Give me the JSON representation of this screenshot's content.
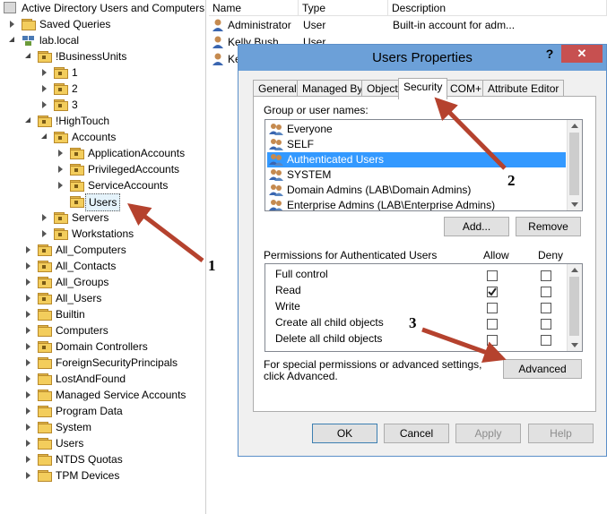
{
  "tree": {
    "root": "Active Directory Users and Computers",
    "items": [
      {
        "label": "Saved Queries"
      },
      {
        "label": "lab.local"
      },
      {
        "label": "!BusinessUnits"
      },
      {
        "label": "1"
      },
      {
        "label": "2"
      },
      {
        "label": "3"
      },
      {
        "label": "!HighTouch"
      },
      {
        "label": "Accounts"
      },
      {
        "label": "ApplicationAccounts"
      },
      {
        "label": "PrivilegedAccounts"
      },
      {
        "label": "ServiceAccounts"
      },
      {
        "label": "Users"
      },
      {
        "label": "Servers"
      },
      {
        "label": "Workstations"
      },
      {
        "label": "All_Computers"
      },
      {
        "label": "All_Contacts"
      },
      {
        "label": "All_Groups"
      },
      {
        "label": "All_Users"
      },
      {
        "label": "Builtin"
      },
      {
        "label": "Computers"
      },
      {
        "label": "Domain Controllers"
      },
      {
        "label": "ForeignSecurityPrincipals"
      },
      {
        "label": "LostAndFound"
      },
      {
        "label": "Managed Service Accounts"
      },
      {
        "label": "Program Data"
      },
      {
        "label": "System"
      },
      {
        "label": "Users"
      },
      {
        "label": "NTDS Quotas"
      },
      {
        "label": "TPM Devices"
      }
    ]
  },
  "list": {
    "columns": [
      "Name",
      "Type",
      "Description"
    ],
    "rows": [
      {
        "name": "Administrator",
        "type": "User",
        "description": "Built-in account for adm..."
      },
      {
        "name": "Kelly Bush",
        "type": "User",
        "description": ""
      },
      {
        "name": "Ke",
        "type": "",
        "description": ""
      }
    ]
  },
  "dialog": {
    "title": "Users Properties",
    "help_label": "?",
    "close_label": "✕",
    "tabs": [
      "General",
      "Managed By",
      "Object",
      "Security",
      "COM+",
      "Attribute Editor"
    ],
    "groups_label": "Group or user names:",
    "groups": [
      "Everyone",
      "SELF",
      "Authenticated Users",
      "SYSTEM",
      "Domain Admins (LAB\\Domain Admins)",
      "Enterprise Admins (LAB\\Enterprise Admins)"
    ],
    "add_label": "Add...",
    "remove_label": "Remove",
    "permissions_label": "Permissions for Authenticated Users",
    "allow_label": "Allow",
    "deny_label": "Deny",
    "permissions": [
      {
        "name": "Full control",
        "allow": false,
        "deny": false
      },
      {
        "name": "Read",
        "allow": true,
        "deny": false
      },
      {
        "name": "Write",
        "allow": false,
        "deny": false
      },
      {
        "name": "Create all child objects",
        "allow": false,
        "deny": false
      },
      {
        "name": "Delete all child objects",
        "allow": false,
        "deny": false
      }
    ],
    "special_text": "For special permissions or advanced settings, click Advanced.",
    "advanced_label": "Advanced",
    "ok_label": "OK",
    "cancel_label": "Cancel",
    "apply_label": "Apply",
    "help_btn_label": "Help"
  },
  "annotations": [
    "1",
    "2",
    "3"
  ],
  "colors": {
    "arrow": "#b5422e",
    "title_bar": "#6ca0d8",
    "selection": "#3399ff",
    "folder": "#f3cd5c"
  }
}
